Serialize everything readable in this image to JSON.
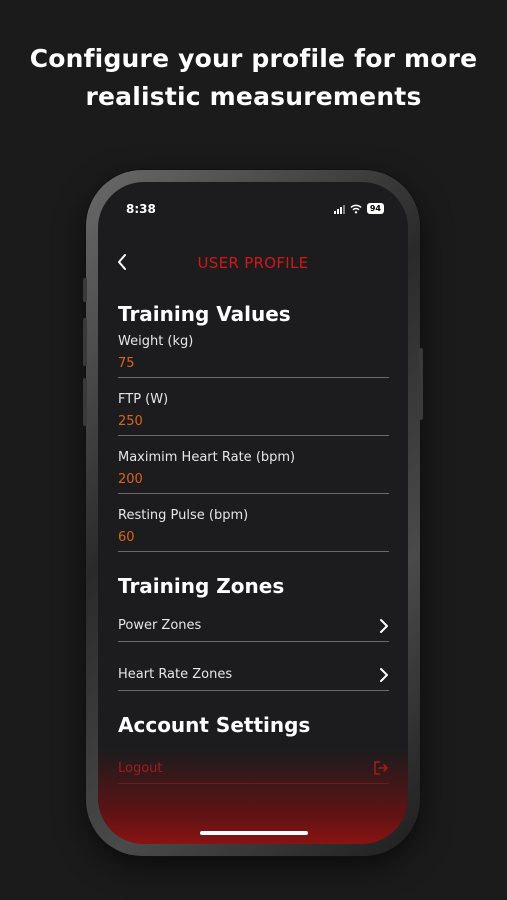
{
  "headline": {
    "line1": "Configure your profile for more",
    "line2": "realistic measurements"
  },
  "status_bar": {
    "time": "8:38",
    "battery": "94"
  },
  "nav": {
    "title": "USER PROFILE",
    "back_icon": "chevron-left-icon"
  },
  "training_values": {
    "title": "Training Values",
    "fields": [
      {
        "label": "Weight (kg)",
        "value": "75"
      },
      {
        "label": "FTP (W)",
        "value": "250"
      },
      {
        "label": "Maximim Heart Rate (bpm)",
        "value": "200"
      },
      {
        "label": "Resting Pulse (bpm)",
        "value": "60"
      }
    ]
  },
  "training_zones": {
    "title": "Training Zones",
    "items": [
      {
        "label": "Power Zones",
        "icon": "chevron-right-icon"
      },
      {
        "label": "Heart Rate Zones",
        "icon": "chevron-right-icon"
      }
    ]
  },
  "account_settings": {
    "title": "Account Settings",
    "logout_label": "Logout",
    "logout_icon": "logout-icon"
  },
  "colors": {
    "accent_red": "#d41616",
    "value_orange": "#d9641f",
    "background": "#1c1c1e"
  }
}
